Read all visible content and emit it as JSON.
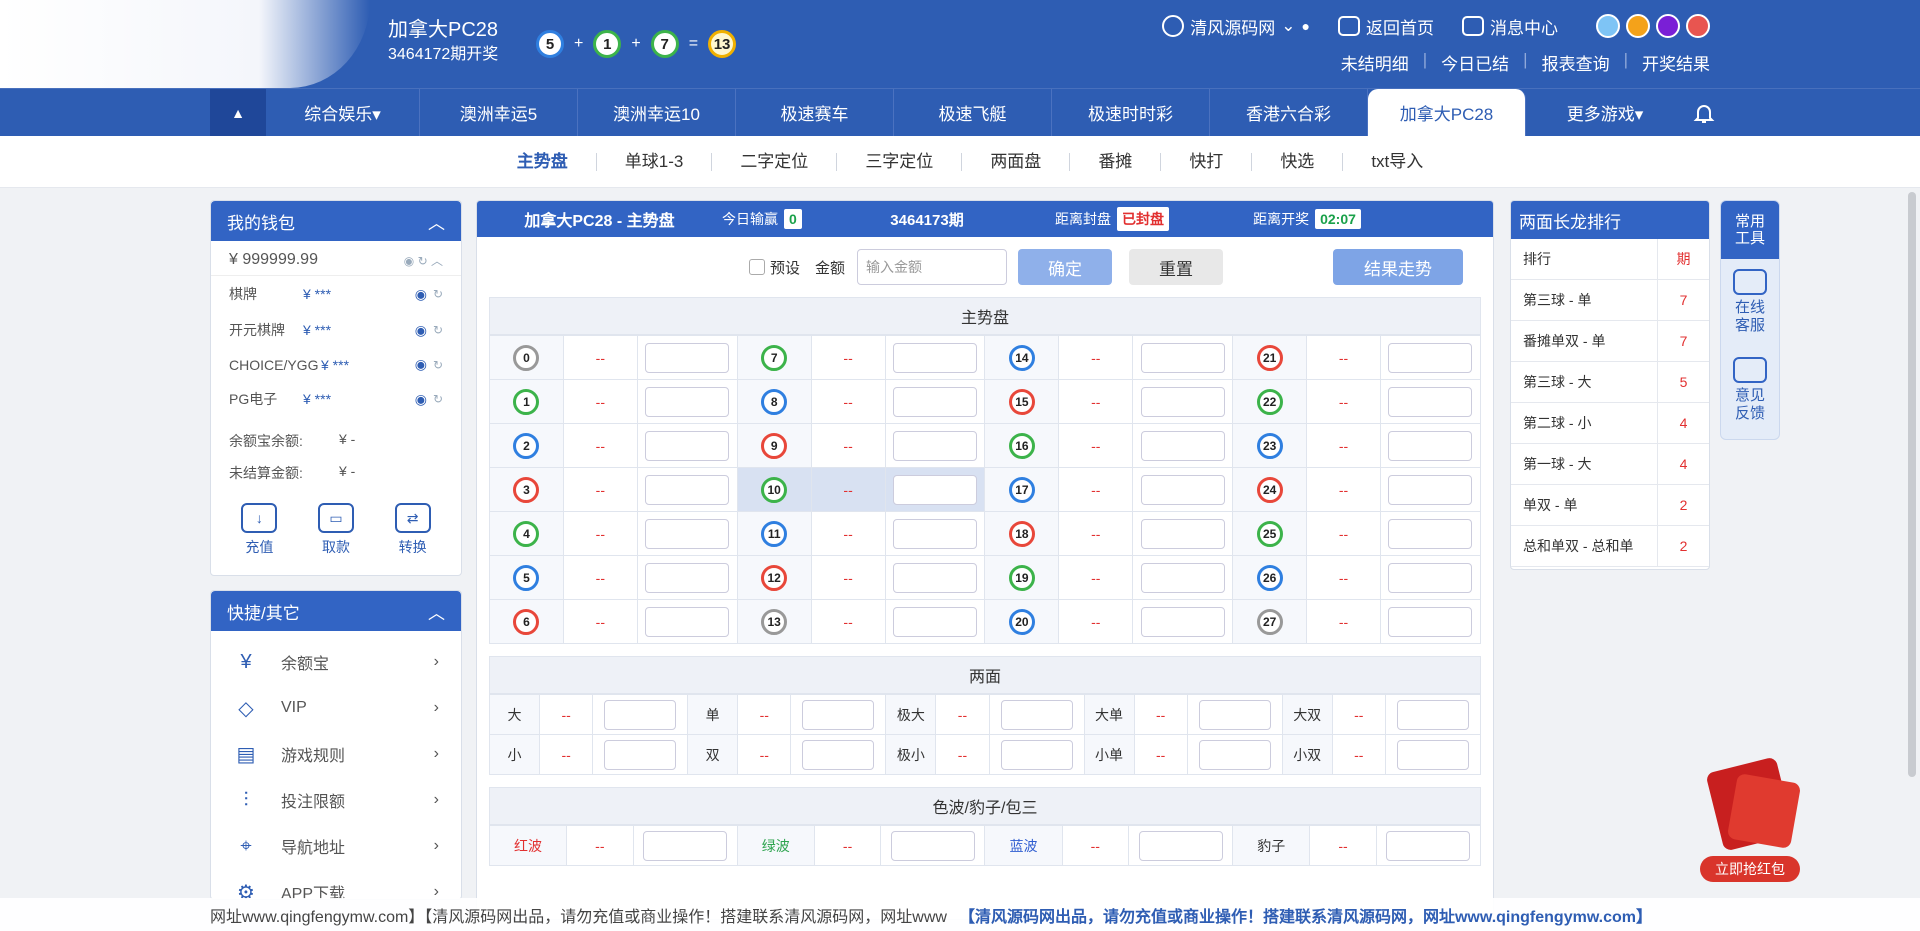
{
  "header": {
    "game_title": "加拿大PC28",
    "issue_text": "3464172期开奖",
    "results": [
      "5",
      "1",
      "7",
      "13"
    ],
    "plus": "+",
    "equals": "=",
    "site_name": "清风源码网",
    "back_home": "返回首页",
    "messages": "消息中心",
    "theme_colors": [
      "#7ec4f5",
      "#f4a21a",
      "#7a1fd6",
      "#e85550"
    ],
    "links": [
      "未结明细",
      "今日已结",
      "报表查询",
      "开奖结果"
    ]
  },
  "nav": {
    "items": [
      "综合娱乐▾",
      "澳洲幸运5",
      "澳洲幸运10",
      "极速赛车",
      "极速飞艇",
      "极速时时彩",
      "香港六合彩",
      "加拿大PC28",
      "更多游戏▾"
    ],
    "active_index": 7,
    "up_arrow": "▲"
  },
  "subnav": {
    "items": [
      "主势盘",
      "单球1-3",
      "二字定位",
      "三字定位",
      "两面盘",
      "番摊",
      "快打",
      "快选",
      "txt导入"
    ],
    "active_index": 0
  },
  "wallet": {
    "title": "我的钱包",
    "balance": "¥ 999999.99",
    "accounts": [
      {
        "label": "棋牌",
        "value": "¥ ***"
      },
      {
        "label": "开元棋牌",
        "value": "¥ ***"
      },
      {
        "label": "CHOICE/YGG",
        "value": "¥ ***"
      },
      {
        "label": "PG电子",
        "value": "¥ ***"
      }
    ],
    "yuebao_label": "余额宝余额:",
    "yuebao_value": "¥ -",
    "unsettled_label": "未结算金额:",
    "unsettled_value": "¥ -",
    "actions": [
      "充值",
      "取款",
      "转换"
    ]
  },
  "quick": {
    "title": "快捷/其它",
    "items": [
      "余额宝",
      "VIP",
      "游戏规则",
      "投注限额",
      "导航地址",
      "APP下载"
    ]
  },
  "main": {
    "title": "加拿大PC28 - 主势盘",
    "today_label": "今日输赢",
    "today_value": "0",
    "issue": "3464173期",
    "close_label": "距离封盘",
    "close_value": "已封盘",
    "open_label": "距离开奖",
    "open_value": "02:07",
    "preset_label": "预设",
    "amount_label": "金额",
    "amount_placeholder": "输入金额",
    "confirm": "确定",
    "reset": "重置",
    "trend": "结果走势",
    "section_main": "主势盘",
    "section_two": "两面",
    "section_color": "色波/豹子/包三",
    "odds_placeholder": "--",
    "ball_rows": [
      [
        {
          "n": "0",
          "c": "gray"
        },
        {
          "n": "7",
          "c": "green"
        },
        {
          "n": "14",
          "c": "blue"
        },
        {
          "n": "21",
          "c": "red"
        }
      ],
      [
        {
          "n": "1",
          "c": "green"
        },
        {
          "n": "8",
          "c": "blue"
        },
        {
          "n": "15",
          "c": "red"
        },
        {
          "n": "22",
          "c": "green"
        }
      ],
      [
        {
          "n": "2",
          "c": "blue"
        },
        {
          "n": "9",
          "c": "red"
        },
        {
          "n": "16",
          "c": "green"
        },
        {
          "n": "23",
          "c": "blue"
        }
      ],
      [
        {
          "n": "3",
          "c": "red"
        },
        {
          "n": "10",
          "c": "green"
        },
        {
          "n": "17",
          "c": "blue"
        },
        {
          "n": "24",
          "c": "red"
        }
      ],
      [
        {
          "n": "4",
          "c": "green"
        },
        {
          "n": "11",
          "c": "blue"
        },
        {
          "n": "18",
          "c": "red"
        },
        {
          "n": "25",
          "c": "green"
        }
      ],
      [
        {
          "n": "5",
          "c": "blue"
        },
        {
          "n": "12",
          "c": "red"
        },
        {
          "n": "19",
          "c": "green"
        },
        {
          "n": "26",
          "c": "blue"
        }
      ],
      [
        {
          "n": "6",
          "c": "red"
        },
        {
          "n": "13",
          "c": "gray"
        },
        {
          "n": "20",
          "c": "blue"
        },
        {
          "n": "27",
          "c": "gray"
        }
      ]
    ],
    "two_rows": [
      [
        "大",
        "单",
        "极大",
        "大单",
        "大双"
      ],
      [
        "小",
        "双",
        "极小",
        "小单",
        "小双"
      ]
    ],
    "color_row": [
      "红波",
      "绿波",
      "蓝波",
      "豹子"
    ]
  },
  "rank": {
    "title": "两面长龙排行",
    "col_name": "排行",
    "col_count": "期",
    "rows": [
      {
        "name": "第三球 - 单",
        "count": "7"
      },
      {
        "name": "番摊单双 - 单",
        "count": "7"
      },
      {
        "name": "第三球 - 大",
        "count": "5"
      },
      {
        "name": "第二球 - 小",
        "count": "4"
      },
      {
        "name": "第一球 - 大",
        "count": "4"
      },
      {
        "name": "单双 - 单",
        "count": "2"
      },
      {
        "name": "总和单双 - 总和单",
        "count": "2"
      }
    ]
  },
  "tools": {
    "title": "常用工具",
    "items": [
      "在线客服",
      "意见反馈"
    ]
  },
  "packet": {
    "label": "立即抢红包"
  },
  "marquee": {
    "text": "网址www.qingfengymw.com】【清风源码网出品，请勿充值或商业操作！搭建联系清风源码网，网址www",
    "hot": "【清风源码网出品，请勿充值或商业操作！搭建联系清风源码网，网址www.qingfengymw.com】"
  }
}
